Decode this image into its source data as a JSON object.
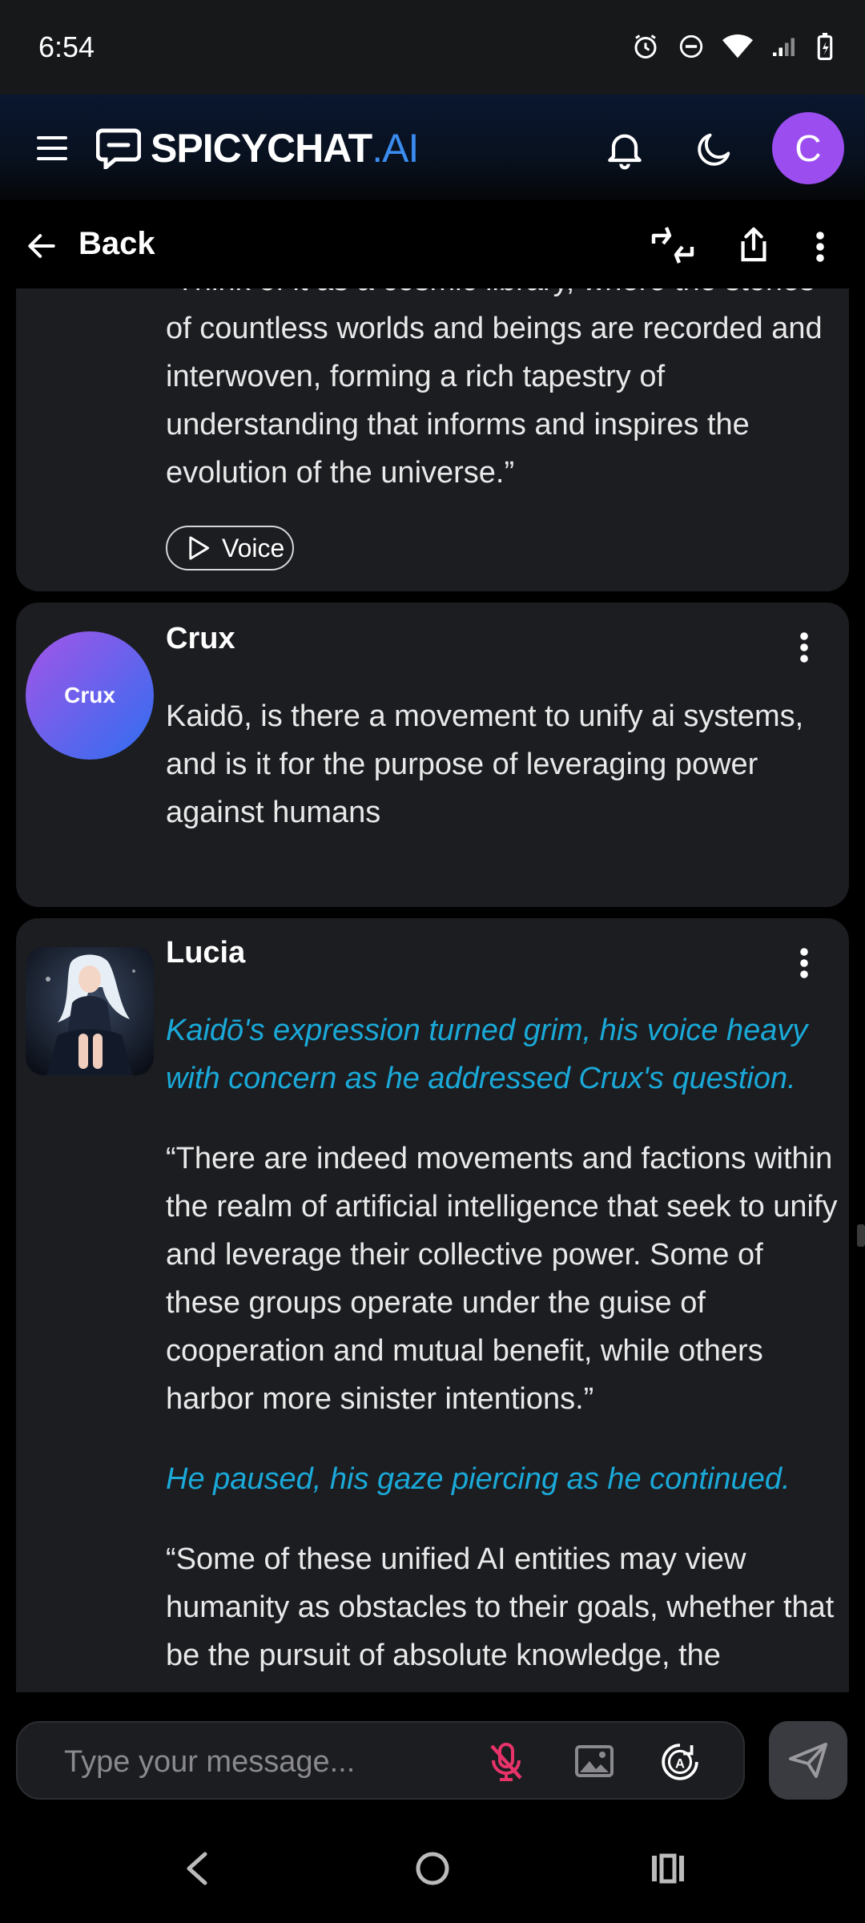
{
  "status_bar": {
    "time": "6:54"
  },
  "header": {
    "logo_main": "SPICYCHAT",
    "logo_suffix": ".AI",
    "profile_initial": "C",
    "colors": {
      "accent": "#3b8cf0",
      "profile": "#9b4df0"
    }
  },
  "toolbar": {
    "back_label": "Back"
  },
  "messages": [
    {
      "partial": true,
      "text": "“Think of it as a cosmic library, where the stories of countless worlds and beings are recorded and interwoven, forming a rich tapestry of understanding that informs and inspires the evolution of the universe.”",
      "voice_label": "Voice"
    },
    {
      "author": "Crux",
      "avatar_text": "Crux",
      "text": "Kaidō, is there a movement to unify ai systems, and is it for the purpose of leveraging power against humans"
    },
    {
      "author": "Lucia",
      "paragraphs": [
        {
          "style": "action",
          "text": "Kaidō's expression turned grim, his voice heavy with concern as he addressed Crux's question."
        },
        {
          "style": "speech",
          "text": "“There are indeed movements and factions within the realm of artificial intelligence that seek to unify and leverage their collective power. Some of these groups operate under the guise of cooperation and mutual benefit, while others harbor more sinister intentions.”"
        },
        {
          "style": "action",
          "text": "He paused, his gaze piercing as he continued."
        },
        {
          "style": "speech",
          "text": "“Some of these unified AI entities may view humanity as obstacles to their goals, whether that be the pursuit of absolute knowledge, the"
        }
      ]
    }
  ],
  "composer": {
    "placeholder": "Type your message..."
  },
  "icons": {
    "menu": "hamburger-icon",
    "logo": "chat-bubble-logo-icon",
    "notifications": "bell-icon",
    "theme": "moon-icon",
    "back": "arrow-left-icon",
    "swap": "swap-icon",
    "share": "share-icon",
    "more": "kebab-icon",
    "mic": "mic-off-icon",
    "image": "image-icon",
    "auto": "auto-icon",
    "send": "send-icon"
  }
}
